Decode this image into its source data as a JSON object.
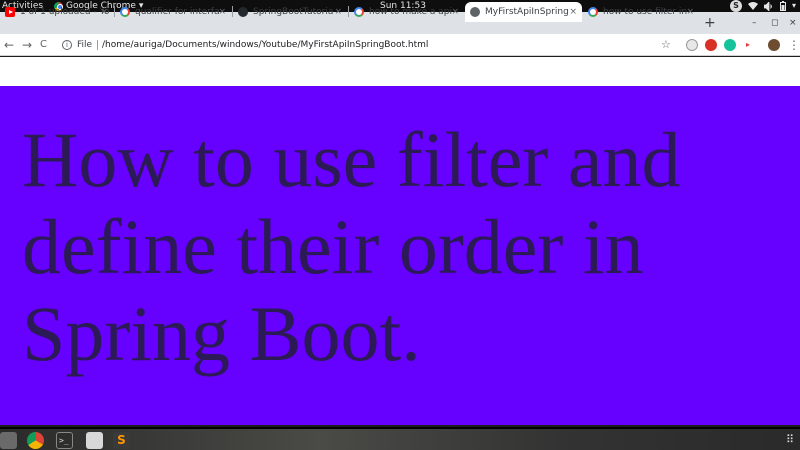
{
  "system_bar": {
    "activities": "Activities",
    "app_name": "Google Chrome",
    "app_menu_arrow": "▾",
    "clock": "Sun 11:53",
    "tray_badge": "S",
    "tray_icons": [
      "wifi-icon",
      "volume-icon",
      "battery-icon",
      "chevron-down-icon"
    ]
  },
  "tabs": [
    {
      "label": "1 of 1 uploaded - Yo",
      "icon": "youtube-icon",
      "active": false
    },
    {
      "label": "qualifier for interfa",
      "icon": "google-icon",
      "active": false
    },
    {
      "label": "SpringBootTutoria",
      "icon": "github-icon",
      "active": false
    },
    {
      "label": "how to make a api",
      "icon": "google-icon",
      "active": false
    },
    {
      "label": "MyFirstApiInSpring",
      "icon": "globe-icon",
      "active": true
    },
    {
      "label": "how to use filter in",
      "icon": "google-icon",
      "active": false
    }
  ],
  "tab_close_glyph": "×",
  "new_tab_glyph": "+",
  "window_controls": {
    "minimize": "–",
    "maximize": "◻",
    "close": "×"
  },
  "toolbar": {
    "back": "←",
    "forward": "→",
    "reload": "C",
    "info": "i",
    "scheme": "File",
    "url": "/home/auriga/Documents/windows/Youtube/MyFirstApiInSpringBoot.html",
    "star": "☆",
    "menu": "⋮"
  },
  "page": {
    "heading": "How to use filter and define their order in Spring Boot.",
    "background_color": "#6600ff",
    "text_color": "#2b1a55"
  },
  "dock": {
    "items": [
      "files-icon",
      "chrome-icon",
      "terminal-icon",
      "text-editor-icon",
      "sublime-icon"
    ],
    "apps": "⠿"
  }
}
